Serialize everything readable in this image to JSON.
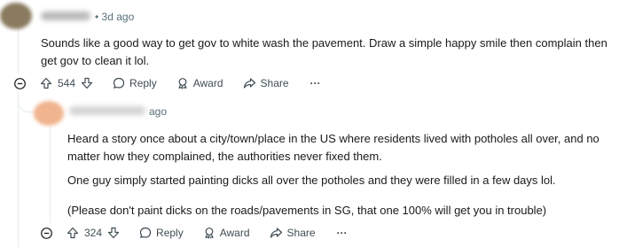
{
  "comments": [
    {
      "timestamp": "• 3d ago",
      "body": [
        "Sounds like a good way to get gov to white wash the pavement. Draw a simple happy smile then complain then get gov to clean it lol."
      ],
      "votes": "544",
      "actions": {
        "reply": "Reply",
        "award": "Award",
        "share": "Share",
        "more": "···"
      }
    },
    {
      "timestamp": "ago",
      "body": [
        "Heard a story once about a city/town/place in the US where residents lived with potholes all over, and no matter how they complained, the authorities never fixed them.",
        "One guy simply started painting dicks all over the potholes and they were filled in a few days lol.",
        "(Please don't paint dicks on the roads/pavements in SG, that one 100% will get you in trouble)"
      ],
      "votes": "324",
      "actions": {
        "reply": "Reply",
        "award": "Award",
        "share": "Share",
        "more": "···"
      }
    }
  ],
  "colors": {
    "link_gray": "#576f76",
    "thread": "#e5ebee"
  }
}
